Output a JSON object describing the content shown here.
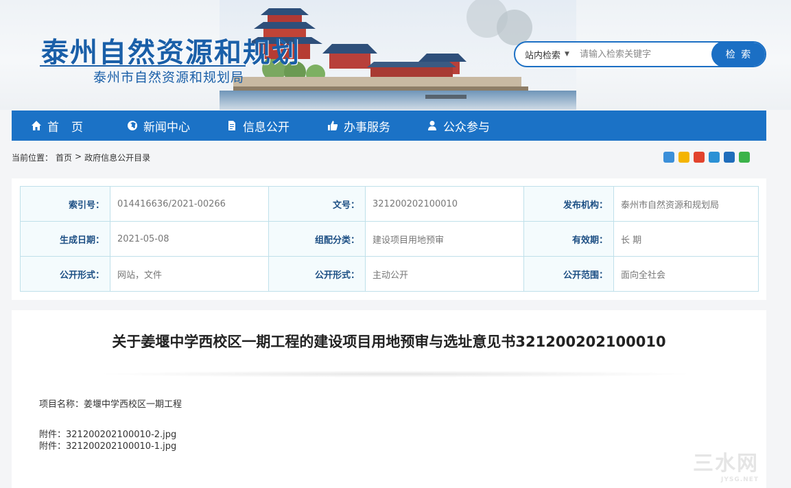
{
  "header": {
    "title": "泰州自然资源和规划",
    "subtitle": "泰州市自然资源和规划局"
  },
  "search": {
    "scope": "站内检索",
    "placeholder": "请输入检索关键字",
    "button": "检 索"
  },
  "nav": {
    "items": [
      {
        "label": "首页",
        "icon": "home-icon"
      },
      {
        "label": "新闻中心",
        "icon": "globe-icon"
      },
      {
        "label": "信息公开",
        "icon": "document-icon"
      },
      {
        "label": "办事服务",
        "icon": "thumbs-up-icon"
      },
      {
        "label": "公众参与",
        "icon": "user-icon"
      }
    ]
  },
  "breadcrumb": {
    "prefix": "当前位置：",
    "home": "首页",
    "sep": ">",
    "current": "政府信息公开目录"
  },
  "share_icons": [
    {
      "name": "share-more-icon",
      "color": "#3b8fd9"
    },
    {
      "name": "share-qzone-icon",
      "color": "#f4b400"
    },
    {
      "name": "share-weibo-icon",
      "color": "#e2432d"
    },
    {
      "name": "share-tencent-icon",
      "color": "#2b91d5"
    },
    {
      "name": "share-renren-icon",
      "color": "#1f6dbb"
    },
    {
      "name": "share-wechat-icon",
      "color": "#3bb34a"
    }
  ],
  "meta": {
    "rows": [
      [
        {
          "key": "索引号：",
          "value": "014416636/2021-00266"
        },
        {
          "key": "文号：",
          "value": "321200202100010"
        },
        {
          "key": "发布机构：",
          "value": "泰州市自然资源和规划局"
        }
      ],
      [
        {
          "key": "生成日期：",
          "value": "2021-05-08"
        },
        {
          "key": "组配分类：",
          "value": "建设项目用地预审"
        },
        {
          "key": "有效期：",
          "value": "长 期"
        }
      ],
      [
        {
          "key": "公开形式：",
          "value": "网站，文件"
        },
        {
          "key": "公开形式：",
          "value": "主动公开"
        },
        {
          "key": "公开范围：",
          "value": "面向全社会"
        }
      ]
    ]
  },
  "document": {
    "title": "关于姜堰中学西校区一期工程的建设项目用地预审与选址意见书321200202100010",
    "project": "项目名称：姜堰中学西校区一期工程",
    "attachment1": "附件：321200202100010-2.jpg",
    "attachment2": "附件：321200202100010-1.jpg"
  },
  "watermark": {
    "text": "三水网",
    "sub": "JYSG.NET"
  }
}
